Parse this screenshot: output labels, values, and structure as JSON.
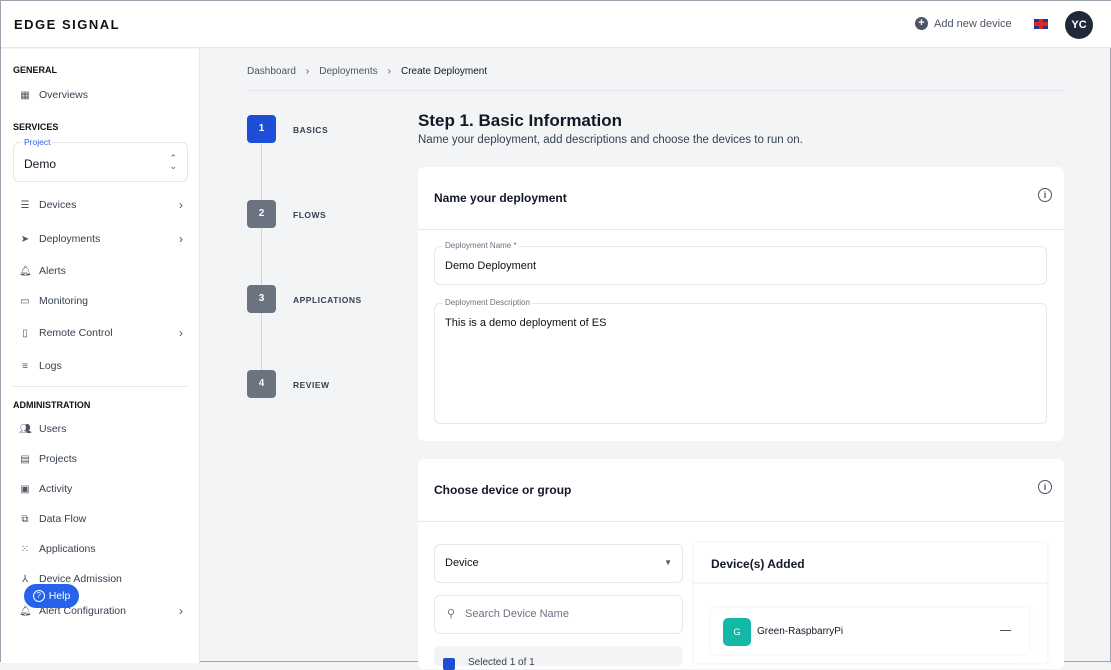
{
  "header": {
    "logo": "EDGE SIGNAL",
    "add_device": "Add new device",
    "language": "en-GB",
    "avatar": "YC"
  },
  "sidebar": {
    "general": "GENERAL",
    "overviews": "Overviews",
    "services": "SERVICES",
    "project": {
      "label": "Project",
      "value": "Demo"
    },
    "services_items": [
      "Devices",
      "Deployments",
      "Alerts",
      "Monitoring",
      "Remote Control",
      "Logs"
    ],
    "administration": "ADMINISTRATION",
    "admin_items": [
      "Users",
      "Projects",
      "Activity",
      "Data Flow",
      "Applications",
      "Device Admission",
      "Alert Configuration"
    ],
    "help": "Help"
  },
  "breadcrumb": [
    "Dashboard",
    "Deployments",
    "Create Deployment"
  ],
  "steps": [
    {
      "num": "1",
      "label": "BASICS"
    },
    {
      "num": "2",
      "label": "FLOWS"
    },
    {
      "num": "3",
      "label": "APPLICATIONS"
    },
    {
      "num": "4",
      "label": "REVIEW"
    }
  ],
  "main": {
    "title": "Step 1. Basic Information",
    "subtitle": "Name your deployment, add descriptions and choose the devices to run on.",
    "name_card": {
      "title": "Name your deployment",
      "name_label": "Deployment Name *",
      "name_value": "Demo Deployment",
      "desc_label": "Deployment Description",
      "desc_value": "This is a demo deployment of ES"
    },
    "device_card": {
      "title": "Choose device or group",
      "type_select": "Device",
      "search_placeholder": "Search Device Name",
      "selected_text": "Selected 1 of 1",
      "added_title": "Device(s) Added",
      "devices": [
        {
          "initial": "G",
          "name": "Green-RaspbarryPi"
        }
      ]
    }
  }
}
